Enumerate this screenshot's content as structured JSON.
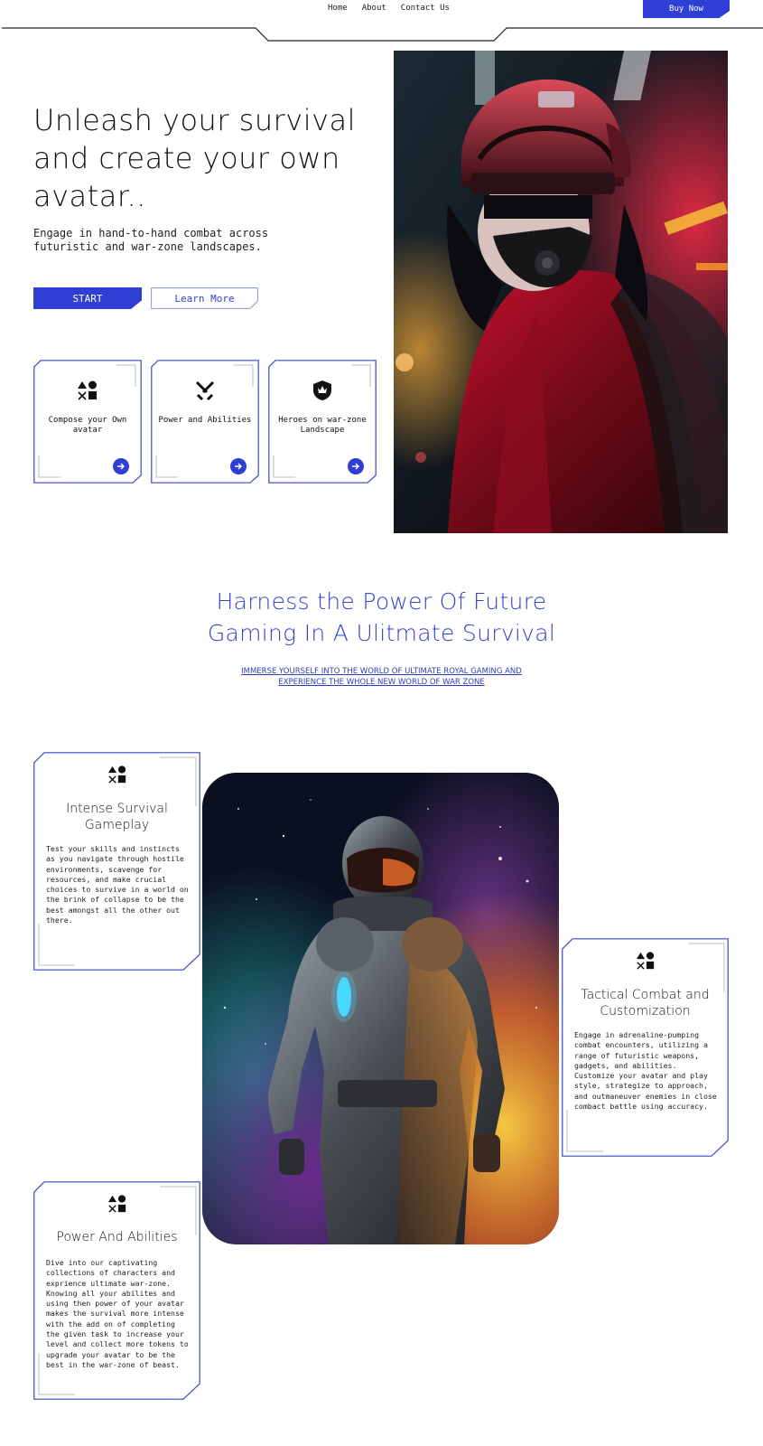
{
  "nav": {
    "links": [
      "Home",
      "About",
      "Contact Us"
    ],
    "buy_label": "Buy Now"
  },
  "hero": {
    "title": "Unleash your survival and create your own avatar..",
    "subtitle": "Engage in hand-to-hand combat across futuristic and war-zone landscapes.",
    "start_label": "START",
    "learn_label": "Learn More",
    "image_icon": "cyberpunk-soldier-portrait",
    "features": [
      {
        "label": "Compose your Own avatar",
        "icon": "shapes-icon"
      },
      {
        "label": "Power and Abilities",
        "icon": "crossed-swords-icon"
      },
      {
        "label": "Heroes on war-zone Landscape",
        "icon": "crown-shield-icon"
      }
    ]
  },
  "section": {
    "title_line1": "Harness the Power Of Future",
    "title_line2": "Gaming In A Ulitmate  Survival",
    "subtitle_line1": "IMMERSE YOURSELF INTO THE WORLD OF ULTIMATE ROYAL GAMING AND",
    "subtitle_line2": "EXPERIENCE THE WHOLE NEW WORLD OF  WAR ZONE"
  },
  "cards": [
    {
      "title": "Intense Survival Gameplay",
      "body": "Test your skills and instincts as you navigate through hostile environments, scavenge for resources, and make crucial choices to survive in a world on the brink of collapse to be the best amongst all the other out there."
    },
    {
      "title": "Tactical Combat and Customization",
      "body": "Engage in adrenaline-pumping combat encounters, utilizing a range of futuristic weapons, gadgets, and abilities. Customize your avatar and play style, strategize to approach, and outmaneuver enemies in close combact battle using accuracy."
    },
    {
      "title": "Power And Abilities",
      "body": "Dive into our captivating collections of characters and exprience ultimate war-zone. Knowing all your abilites and using then power of your avatar makes the survival more intense with the add on of completing the given task to increase your level and collect more tokens to upgrade your avatar to be the best in the war-zone of beast."
    }
  ],
  "robot_image_icon": "armored-robot-nebula",
  "colors": {
    "accent": "#2f3fd6",
    "heading_blue": "#3443c8"
  }
}
